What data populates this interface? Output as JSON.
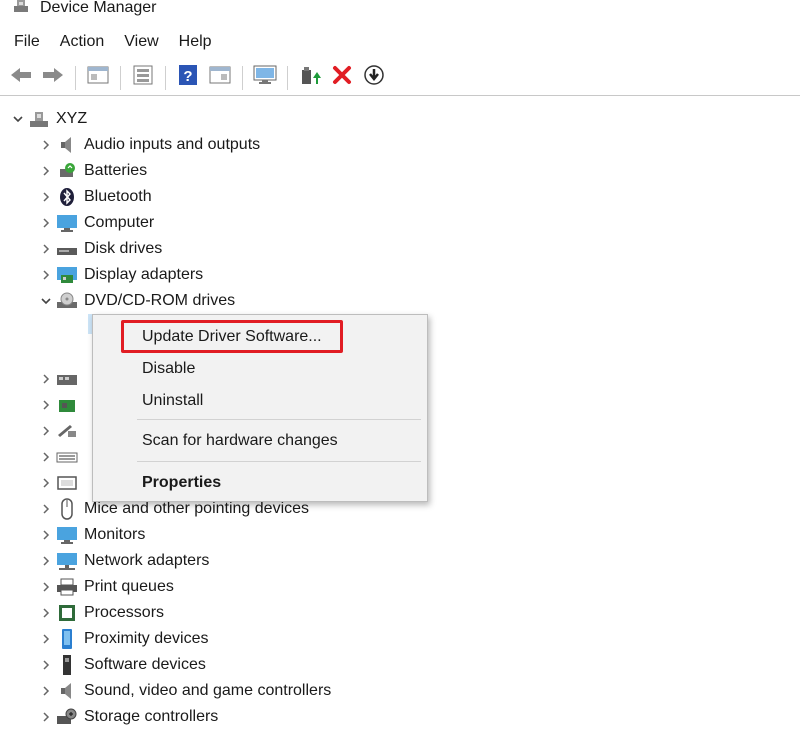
{
  "window": {
    "title": "Device Manager",
    "icon": "device-manager-icon"
  },
  "menu": [
    "File",
    "Action",
    "View",
    "Help"
  ],
  "toolbar": [
    "back-arrow-icon",
    "forward-arrow-icon",
    "properties-icon",
    "show-hide-icon",
    "help-icon",
    "console-icon",
    "monitor-icon",
    "update-driver-icon",
    "uninstall-icon",
    "scan-download-icon"
  ],
  "tree": {
    "root": {
      "label": "XYZ",
      "icon": "computer-tree-icon",
      "expanded": true
    },
    "items": [
      {
        "label": "Audio inputs and outputs",
        "icon": "speaker-icon"
      },
      {
        "label": "Batteries",
        "icon": "battery-icon"
      },
      {
        "label": "Bluetooth",
        "icon": "bluetooth-icon"
      },
      {
        "label": "Computer",
        "icon": "monitor-icon"
      },
      {
        "label": "Disk drives",
        "icon": "disk-drive-icon"
      },
      {
        "label": "Display adapters",
        "icon": "display-adapter-icon"
      },
      {
        "label": "DVD/CD-ROM drives",
        "icon": "dvd-drive-icon",
        "expanded": true
      },
      {
        "label": "",
        "icon": "hid-icon"
      },
      {
        "label": "",
        "icon": "ide-icon"
      },
      {
        "label": "",
        "icon": "imaging-icon"
      },
      {
        "label": "",
        "icon": "keyboard-icon"
      },
      {
        "label": "",
        "icon": "memory-icon"
      },
      {
        "label": "Mice and other pointing devices",
        "icon": "mouse-icon"
      },
      {
        "label": "Monitors",
        "icon": "monitor-icon"
      },
      {
        "label": "Network adapters",
        "icon": "network-adapter-icon"
      },
      {
        "label": "Print queues",
        "icon": "printer-icon"
      },
      {
        "label": "Processors",
        "icon": "processor-icon"
      },
      {
        "label": "Proximity devices",
        "icon": "proximity-icon"
      },
      {
        "label": "Software devices",
        "icon": "software-device-icon"
      },
      {
        "label": "Sound, video and game controllers",
        "icon": "speaker-icon"
      },
      {
        "label": "Storage controllers",
        "icon": "storage-controller-icon"
      }
    ]
  },
  "context_menu": {
    "items": [
      {
        "label": "Update Driver Software...",
        "highlighted": true
      },
      {
        "label": "Disable"
      },
      {
        "label": "Uninstall"
      },
      {
        "label": "Scan for hardware changes"
      },
      {
        "label": "Properties",
        "bold": true
      }
    ],
    "highlight_color": "#e11d24"
  }
}
